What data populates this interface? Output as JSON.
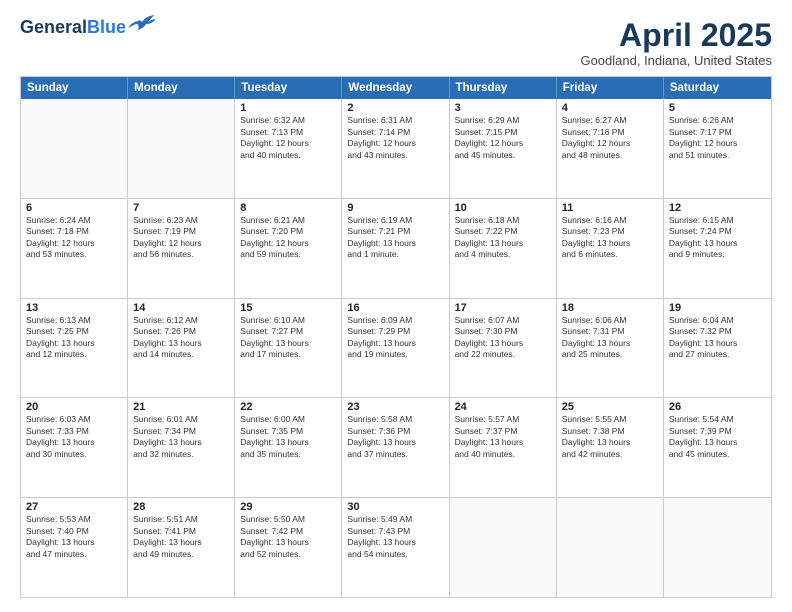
{
  "header": {
    "logo_line1": "General",
    "logo_line2": "Blue",
    "month": "April 2025",
    "location": "Goodland, Indiana, United States"
  },
  "days_of_week": [
    "Sunday",
    "Monday",
    "Tuesday",
    "Wednesday",
    "Thursday",
    "Friday",
    "Saturday"
  ],
  "weeks": [
    [
      {
        "day": "",
        "lines": []
      },
      {
        "day": "",
        "lines": []
      },
      {
        "day": "1",
        "lines": [
          "Sunrise: 6:32 AM",
          "Sunset: 7:13 PM",
          "Daylight: 12 hours",
          "and 40 minutes."
        ]
      },
      {
        "day": "2",
        "lines": [
          "Sunrise: 6:31 AM",
          "Sunset: 7:14 PM",
          "Daylight: 12 hours",
          "and 43 minutes."
        ]
      },
      {
        "day": "3",
        "lines": [
          "Sunrise: 6:29 AM",
          "Sunset: 7:15 PM",
          "Daylight: 12 hours",
          "and 45 minutes."
        ]
      },
      {
        "day": "4",
        "lines": [
          "Sunrise: 6:27 AM",
          "Sunset: 7:16 PM",
          "Daylight: 12 hours",
          "and 48 minutes."
        ]
      },
      {
        "day": "5",
        "lines": [
          "Sunrise: 6:26 AM",
          "Sunset: 7:17 PM",
          "Daylight: 12 hours",
          "and 51 minutes."
        ]
      }
    ],
    [
      {
        "day": "6",
        "lines": [
          "Sunrise: 6:24 AM",
          "Sunset: 7:18 PM",
          "Daylight: 12 hours",
          "and 53 minutes."
        ]
      },
      {
        "day": "7",
        "lines": [
          "Sunrise: 6:23 AM",
          "Sunset: 7:19 PM",
          "Daylight: 12 hours",
          "and 56 minutes."
        ]
      },
      {
        "day": "8",
        "lines": [
          "Sunrise: 6:21 AM",
          "Sunset: 7:20 PM",
          "Daylight: 12 hours",
          "and 59 minutes."
        ]
      },
      {
        "day": "9",
        "lines": [
          "Sunrise: 6:19 AM",
          "Sunset: 7:21 PM",
          "Daylight: 13 hours",
          "and 1 minute."
        ]
      },
      {
        "day": "10",
        "lines": [
          "Sunrise: 6:18 AM",
          "Sunset: 7:22 PM",
          "Daylight: 13 hours",
          "and 4 minutes."
        ]
      },
      {
        "day": "11",
        "lines": [
          "Sunrise: 6:16 AM",
          "Sunset: 7:23 PM",
          "Daylight: 13 hours",
          "and 6 minutes."
        ]
      },
      {
        "day": "12",
        "lines": [
          "Sunrise: 6:15 AM",
          "Sunset: 7:24 PM",
          "Daylight: 13 hours",
          "and 9 minutes."
        ]
      }
    ],
    [
      {
        "day": "13",
        "lines": [
          "Sunrise: 6:13 AM",
          "Sunset: 7:25 PM",
          "Daylight: 13 hours",
          "and 12 minutes."
        ]
      },
      {
        "day": "14",
        "lines": [
          "Sunrise: 6:12 AM",
          "Sunset: 7:26 PM",
          "Daylight: 13 hours",
          "and 14 minutes."
        ]
      },
      {
        "day": "15",
        "lines": [
          "Sunrise: 6:10 AM",
          "Sunset: 7:27 PM",
          "Daylight: 13 hours",
          "and 17 minutes."
        ]
      },
      {
        "day": "16",
        "lines": [
          "Sunrise: 6:09 AM",
          "Sunset: 7:29 PM",
          "Daylight: 13 hours",
          "and 19 minutes."
        ]
      },
      {
        "day": "17",
        "lines": [
          "Sunrise: 6:07 AM",
          "Sunset: 7:30 PM",
          "Daylight: 13 hours",
          "and 22 minutes."
        ]
      },
      {
        "day": "18",
        "lines": [
          "Sunrise: 6:06 AM",
          "Sunset: 7:31 PM",
          "Daylight: 13 hours",
          "and 25 minutes."
        ]
      },
      {
        "day": "19",
        "lines": [
          "Sunrise: 6:04 AM",
          "Sunset: 7:32 PM",
          "Daylight: 13 hours",
          "and 27 minutes."
        ]
      }
    ],
    [
      {
        "day": "20",
        "lines": [
          "Sunrise: 6:03 AM",
          "Sunset: 7:33 PM",
          "Daylight: 13 hours",
          "and 30 minutes."
        ]
      },
      {
        "day": "21",
        "lines": [
          "Sunrise: 6:01 AM",
          "Sunset: 7:34 PM",
          "Daylight: 13 hours",
          "and 32 minutes."
        ]
      },
      {
        "day": "22",
        "lines": [
          "Sunrise: 6:00 AM",
          "Sunset: 7:35 PM",
          "Daylight: 13 hours",
          "and 35 minutes."
        ]
      },
      {
        "day": "23",
        "lines": [
          "Sunrise: 5:58 AM",
          "Sunset: 7:36 PM",
          "Daylight: 13 hours",
          "and 37 minutes."
        ]
      },
      {
        "day": "24",
        "lines": [
          "Sunrise: 5:57 AM",
          "Sunset: 7:37 PM",
          "Daylight: 13 hours",
          "and 40 minutes."
        ]
      },
      {
        "day": "25",
        "lines": [
          "Sunrise: 5:55 AM",
          "Sunset: 7:38 PM",
          "Daylight: 13 hours",
          "and 42 minutes."
        ]
      },
      {
        "day": "26",
        "lines": [
          "Sunrise: 5:54 AM",
          "Sunset: 7:39 PM",
          "Daylight: 13 hours",
          "and 45 minutes."
        ]
      }
    ],
    [
      {
        "day": "27",
        "lines": [
          "Sunrise: 5:53 AM",
          "Sunset: 7:40 PM",
          "Daylight: 13 hours",
          "and 47 minutes."
        ]
      },
      {
        "day": "28",
        "lines": [
          "Sunrise: 5:51 AM",
          "Sunset: 7:41 PM",
          "Daylight: 13 hours",
          "and 49 minutes."
        ]
      },
      {
        "day": "29",
        "lines": [
          "Sunrise: 5:50 AM",
          "Sunset: 7:42 PM",
          "Daylight: 13 hours",
          "and 52 minutes."
        ]
      },
      {
        "day": "30",
        "lines": [
          "Sunrise: 5:49 AM",
          "Sunset: 7:43 PM",
          "Daylight: 13 hours",
          "and 54 minutes."
        ]
      },
      {
        "day": "",
        "lines": []
      },
      {
        "day": "",
        "lines": []
      },
      {
        "day": "",
        "lines": []
      }
    ]
  ]
}
